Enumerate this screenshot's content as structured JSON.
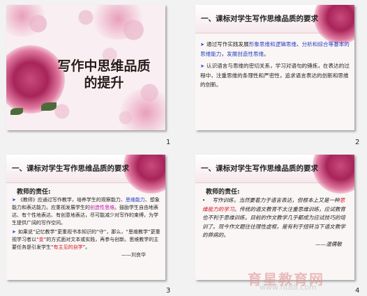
{
  "slides": [
    {
      "number": "1",
      "title_line1": "写作中思维品质",
      "title_line2": "的提升"
    },
    {
      "number": "2",
      "header": "一、课标对学生写作思维品质的要求",
      "items": [
        {
          "parts": [
            "通过写作实践发展",
            "形象思维和逻辑思维",
            "、",
            "分析和综合等基本的思维能力",
            "，",
            "发展创造性思维",
            "。"
          ]
        },
        {
          "text": "认识语言与思维的密切关系，学习对语句的锤炼，在表达的过程中，注重思维的条理性和严密性，追求语言表达的创新和思维的创新。"
        }
      ]
    },
    {
      "number": "3",
      "header": "一、课标对学生写作思维品质的要求",
      "label": "教师的责任:",
      "para1_parts": [
        "《教师》应通过写作教学，培养学生的观察能力、",
        "思维能力",
        "、想象能力和表达能力。应重视发展学生的",
        "创造性思维",
        "。鼓励学生自由地表达、有个性地表达、有创意地表达，尽可能减少对写作的束缚，为学生提供广阔的写作空间。"
      ],
      "para2_parts": [
        "如果说“记忆教学”更重视书本知识的“守”，那么，“思维教学”更重视学习者以“",
        "变",
        "”的方式面对文本或实践，再参与创新。思维教学的主要任务是引发学生“",
        "有主见的自学",
        "”。"
      ],
      "signature": "——刘良华"
    },
    {
      "number": "4",
      "header": "一、课标对学生写作思维品质的要求",
      "label": "教师的责任:",
      "quote_parts": [
        "写作训练，当然要着力于语言表达，但根本上又是一种",
        "思维能力的学习",
        "。传统的语文教育不太注重思维训练，应试教育也不利于思维训练，目前的作文教学几乎都成为应试技巧的培训了。现今作文题往往理性虚框，是有利于扭转当下语文教学的弊病的。"
      ],
      "signature": "——温儒敏"
    }
  ],
  "watermark": {
    "logo": "育星教育网",
    "url": "www.ht88.com"
  }
}
